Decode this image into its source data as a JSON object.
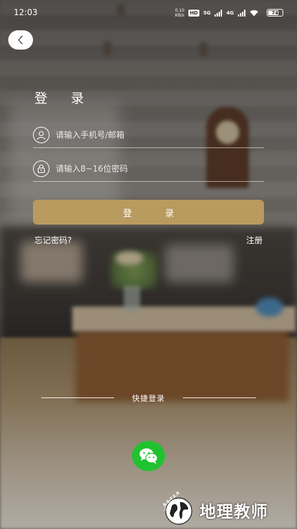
{
  "status_bar": {
    "time": "12:03",
    "net_speed_value": "0.10",
    "net_speed_unit": "KB/s",
    "hd_badge": "HD",
    "net_type_1": "5G",
    "net_type_2": "4G",
    "battery": "74",
    "battery_level": 0.74
  },
  "login": {
    "title": "登 录",
    "phone_placeholder": "请输入手机号/邮箱",
    "password_placeholder": "请输入8~16位密码",
    "submit_label": "登 录",
    "forgot_label": "忘记密码?",
    "register_label": "注册"
  },
  "quick_login": {
    "label": "快捷登录"
  },
  "watermark": {
    "text": "地理教师",
    "logo_text": "A.S.T.E.R"
  },
  "colors": {
    "login_button": "#b99a5f",
    "wechat": "#21c230"
  },
  "icons": {
    "back": "chevron-left-icon",
    "user": "user-icon",
    "lock": "lock-icon",
    "wechat": "wechat-icon",
    "wifi": "wifi-icon"
  }
}
